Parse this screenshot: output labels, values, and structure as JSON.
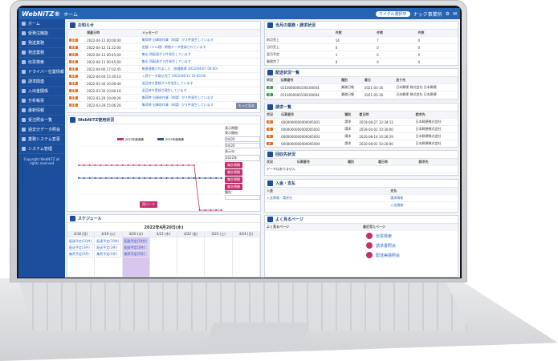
{
  "topbar": {
    "logo": "WebNiTZ®",
    "breadcrumb": "ホーム",
    "right_items": [
      "マイクル選択中",
      "ナック事業所"
    ]
  },
  "sidebar": {
    "items": [
      "ホーム",
      "受発注機能",
      "発送業務",
      "発送業務",
      "伝票検索",
      "ドライバー位置情報",
      "請求関連",
      "入出金関係",
      "分析帳票",
      "最新情報",
      "受注照会一覧",
      "過去分データ照会",
      "業務システム変更",
      "システム管理"
    ],
    "note": "Copyright WebNiTZ all rights reserved"
  },
  "notices": {
    "title": "お知らせ",
    "columns": [
      "掲載日時",
      "メッセージ"
    ],
    "rows": [
      {
        "tag": "重要",
        "date": "2022-04-12 00:00:00",
        "msg": "集荷時 出庫前作業（申請）が３件発生しています"
      },
      {
        "tag": "重要",
        "date": "2022-04-12 11:22:00",
        "msg": "定額（ドル建）期間データ登録されています"
      },
      {
        "tag": "重要",
        "date": "2022-04-11 00:45:00",
        "msg": "集出 再配達が２件発生しています"
      },
      {
        "tag": "重要",
        "date": "2022-04-11 00:45:00",
        "msg": "集出 再配達が２件発生しています"
      },
      {
        "tag": "重要",
        "date": "2022-04-06 17:02:45",
        "msg": "帳票連携されました（各種帳票 2022/04/07 00:00）"
      },
      {
        "tag": "重要",
        "date": "2022-04-04 15:30:10",
        "msg": "入荷データ取込完了 2022/04/13 10:00:00"
      },
      {
        "tag": "重要",
        "date": "2022-03-30 10:00:44",
        "msg": "返品待ち登録が３件発生しています"
      },
      {
        "tag": "重要",
        "date": "2022-03-30 10:00:16",
        "msg": "返品待ち登録が発生しています"
      },
      {
        "tag": "重要",
        "date": "2022-03-29 19:00:26",
        "msg": "集荷時 出庫前作業（申請）が２件発生しています"
      },
      {
        "tag": "重要",
        "date": "2022-03-29 15:06:26",
        "msg": "集荷時 出庫前作業（申請）が３件発生しています"
      }
    ],
    "more_label": "もっと見る"
  },
  "trend": {
    "title": "WebNiTZ使用状況",
    "legend": [
      "2022年度実績",
      "2021年度実績"
    ],
    "side": {
      "period_label": "表示期間：",
      "start_label": "表示開始：",
      "start_value": "04/20",
      "end_value": "04/20",
      "year_label": "表示年：",
      "year_value": "2022年",
      "buttons": [
        "集計期間",
        "集計期間",
        "集計期間",
        "集計期間"
      ],
      "type_label": "種別：",
      "update_label": "更新"
    },
    "bottom_button": "再ロード"
  },
  "chart_data": {
    "type": "line",
    "series": [
      {
        "name": "2022年度実績",
        "values": [
          14,
          14,
          14,
          14,
          14,
          14,
          14,
          14,
          14,
          14,
          14,
          14,
          14,
          14,
          14,
          14,
          14,
          14,
          14,
          14,
          14,
          14,
          0,
          0,
          0,
          0,
          0
        ]
      },
      {
        "name": "2021年度実績",
        "values": [
          10,
          10,
          10,
          10,
          10,
          10,
          10,
          10,
          10,
          10,
          10,
          10,
          10,
          10,
          10,
          10,
          10,
          10,
          10,
          10,
          10,
          10,
          10,
          10,
          10,
          10,
          10
        ]
      }
    ],
    "ylim": [
      0,
      20
    ],
    "grid": true,
    "legend": "top"
  },
  "schedule": {
    "title": "スケジュール",
    "month_label": "2022年4月20日(水)",
    "days": [
      "4/18 (月)",
      "4/19 (火)",
      "4/20 (水)",
      "4/21 (木)",
      "4/22 (金)",
      "4/23 (土)",
      "4/24 (日)"
    ],
    "events": [
      "配達予定(10件)",
      "配送予定(3件)",
      "集荷予定(5件)"
    ],
    "nav": [
      "前週",
      "今日",
      "翌週",
      "月表示"
    ]
  },
  "summary": {
    "title": "当月の業務・請求状況",
    "columns": [
      "件数",
      "件数",
      "件数",
      "件数"
    ],
    "rows": [
      [
        "前月売上",
        "14",
        "7",
        "0"
      ],
      [
        "当月売上",
        "0",
        "0",
        "0"
      ],
      [
        "翌月予定",
        "1",
        "0",
        "0"
      ],
      [
        "業務完了",
        "0",
        "0",
        "0"
      ]
    ]
  },
  "list1": {
    "title": "配送状況一覧",
    "columns": [
      "状況",
      "伝票番号",
      "種別",
      "着日",
      "送り先"
    ],
    "rows": [
      [
        "済",
        "0110000000100100004",
        "業務日報",
        "2021-03-16",
        "日本郵便 株式会社 日本郵便"
      ],
      [
        "済",
        "0110000000100100004",
        "業務日報",
        "2021-03-16",
        "日本郵便 株式会社 日本郵便"
      ]
    ]
  },
  "list2": {
    "title": "請求一覧",
    "columns": [
      "状況",
      "伝票番号",
      "種別",
      "着日時",
      "請求先"
    ],
    "rows": [
      [
        "未",
        "0000000000000005001",
        "請求",
        "2019-08-27 12:34:12",
        "日本郵便株式会社"
      ],
      [
        "未",
        "0000000000000005002",
        "請求",
        "2019-04-01 10:30:00",
        "日本郵便株式会社"
      ],
      [
        "未",
        "0000000000000005003",
        "請求",
        "2020-08-14 14:26:29",
        "日本郵便株式会社"
      ],
      [
        "未",
        "0000000000000005004",
        "請求",
        "2020-08-01 10:20:00",
        "日本郵便株式会社"
      ],
      [
        "未",
        "0000000000000005005",
        "請求",
        "2020-10-29 15:39:13",
        "日本郵便株式会社"
      ]
    ]
  },
  "list3": {
    "title": "回収先状況",
    "columns": [
      "状況",
      "伝票番号",
      "種別",
      "着日時",
      "請求先"
    ],
    "empty": "データはありません"
  },
  "inout": {
    "title": "入金・支払",
    "columns": [
      "入金",
      "支払"
    ],
    "left": [
      "入金情報・請求先"
    ],
    "right": [
      "請求情報",
      "入金情報"
    ]
  },
  "favorites": {
    "title": "よく見るページ",
    "columns": [
      "よく見るページ",
      "最近見たページ"
    ],
    "items": [
      "伝票検索",
      "請求書照会",
      "配達実績照会"
    ]
  }
}
